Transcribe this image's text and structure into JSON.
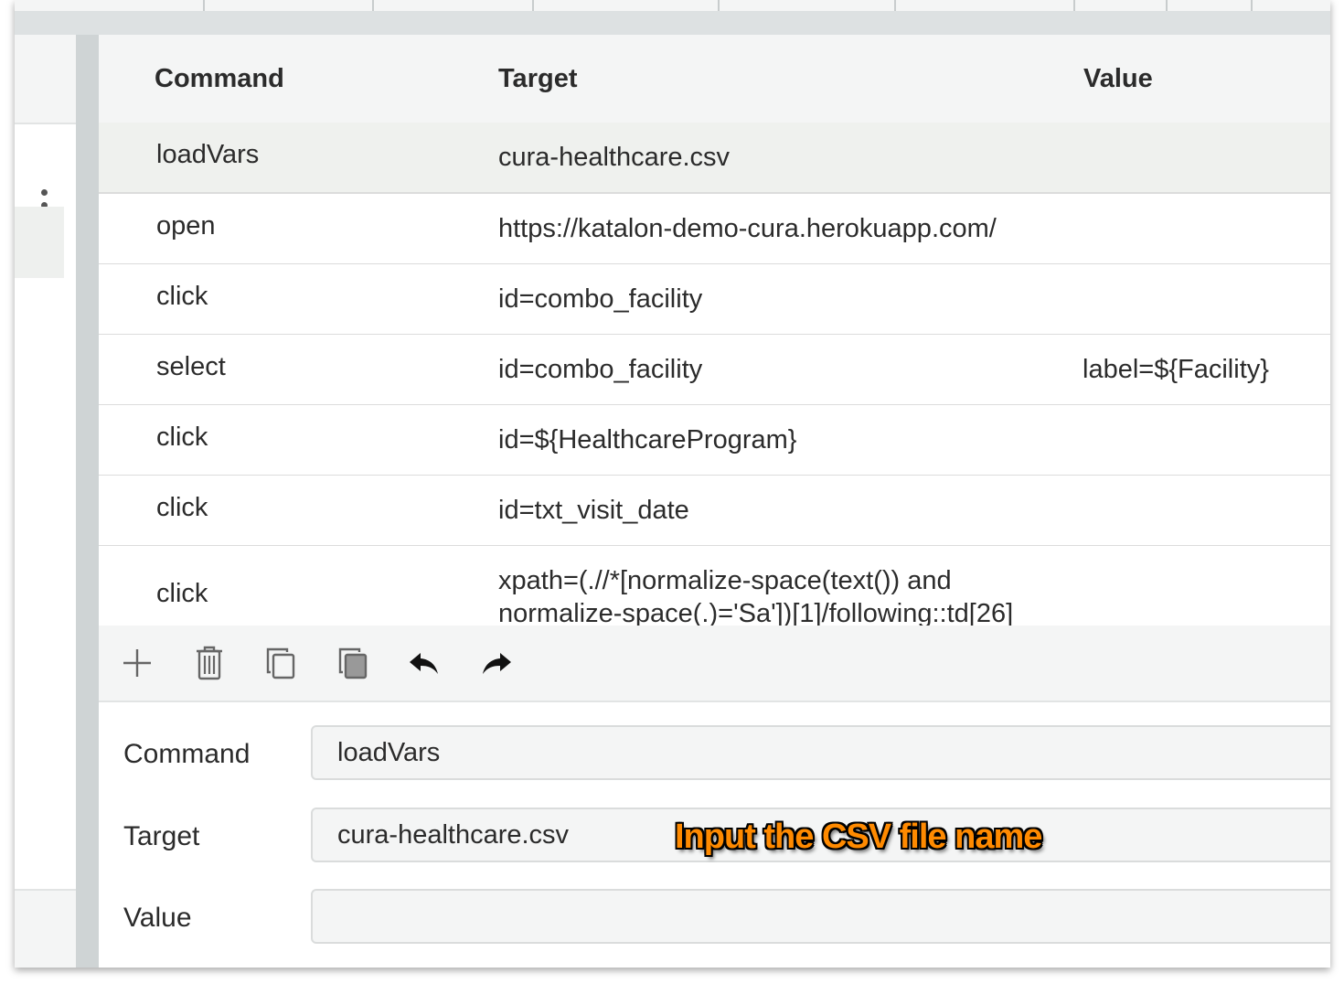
{
  "table": {
    "headers": {
      "command": "Command",
      "target": "Target",
      "value": "Value"
    },
    "rows": [
      {
        "command": "loadVars",
        "target": "cura-healthcare.csv",
        "value": ""
      },
      {
        "command": "open",
        "target": "https://katalon-demo-cura.herokuapp.com/",
        "value": ""
      },
      {
        "command": "click",
        "target": "id=combo_facility",
        "value": ""
      },
      {
        "command": "select",
        "target": "id=combo_facility",
        "value": "label=${Facility}"
      },
      {
        "command": "click",
        "target": "id=${HealthcareProgram}",
        "value": ""
      },
      {
        "command": "click",
        "target": "id=txt_visit_date",
        "value": ""
      },
      {
        "command": "click",
        "target": "xpath=(.//*[normalize-space(text()) and normalize-space(.)='Sa'])[1]/following::td[26]",
        "value": ""
      }
    ],
    "selected_row": 0
  },
  "toolbar": {
    "icons": [
      "add-icon",
      "delete-icon",
      "copy-icon",
      "paste-icon",
      "undo-icon",
      "redo-icon"
    ]
  },
  "editor": {
    "command_label": "Command",
    "command_value": "loadVars",
    "target_label": "Target",
    "target_value": "cura-healthcare.csv",
    "value_label": "Value",
    "value_value": ""
  },
  "annotation": {
    "text": "Input the CSV file name",
    "color": "#ff8a00"
  }
}
